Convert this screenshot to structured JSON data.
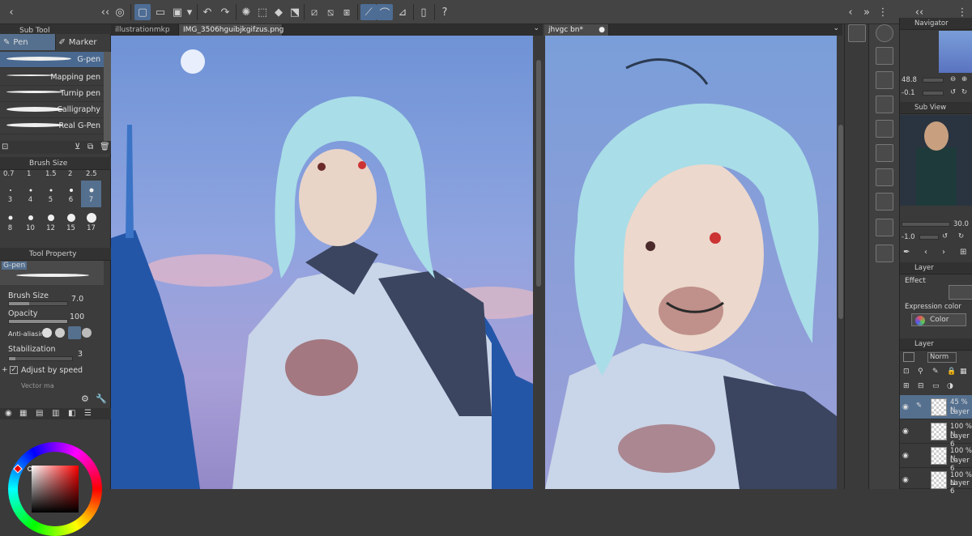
{
  "documents": {
    "left_tabs": [
      "illustrationmkp",
      "IMG_3506hguibjkgifzus.png"
    ],
    "right_tabs": [
      "jhvgc bn*"
    ]
  },
  "subtool": {
    "header": "Sub Tool",
    "tabs": [
      "Pen",
      "Marker"
    ],
    "brushes": [
      "G-pen",
      "Mapping pen",
      "Turnip pen",
      "Calligraphy",
      "Real G-Pen"
    ]
  },
  "brush_size": {
    "header": "Brush Size",
    "top_values": [
      "0.7",
      "1",
      "1.5",
      "2",
      "2.5"
    ],
    "rows": [
      [
        "3",
        "4",
        "5",
        "6",
        "7"
      ],
      [
        "8",
        "10",
        "12",
        "15",
        "17"
      ]
    ],
    "selected": "7"
  },
  "tool_property": {
    "header": "Tool Property",
    "brush_name": "G-pen",
    "brush_size_label": "Brush Size",
    "brush_size_value": "7.0",
    "opacity_label": "Opacity",
    "opacity_value": "100",
    "antialias_label": "Anti-aliasing",
    "stabilization_label": "Stabilization",
    "stabilization_value": "3",
    "adjust_label": "Adjust by speed",
    "vector_label": "Vector ma"
  },
  "navigator": {
    "header": "Navigator",
    "zoom": "48.8",
    "angle": "-0.1"
  },
  "subview": {
    "header": "Sub View",
    "zoom": "30.0",
    "angle": "-1.0"
  },
  "layer_property": {
    "header": "Layer",
    "effect_label": "Effect",
    "expression_label": "Expression color",
    "expression_value": "Color"
  },
  "layers": {
    "header": "Layer",
    "blend_mode": "Norm",
    "rows": [
      {
        "line1": "45 % N",
        "line2": "Layer",
        "selected": true
      },
      {
        "line1": "100 % N",
        "line2": "Layer 6",
        "selected": false
      },
      {
        "line1": "100 % N",
        "line2": "Layer 6",
        "selected": false
      },
      {
        "line1": "100 % N",
        "line2": "Layer 6",
        "selected": false
      }
    ]
  },
  "colors": {
    "accent": "#55708f",
    "sky": "#7f9ed9",
    "hair": "#a9dde8"
  }
}
